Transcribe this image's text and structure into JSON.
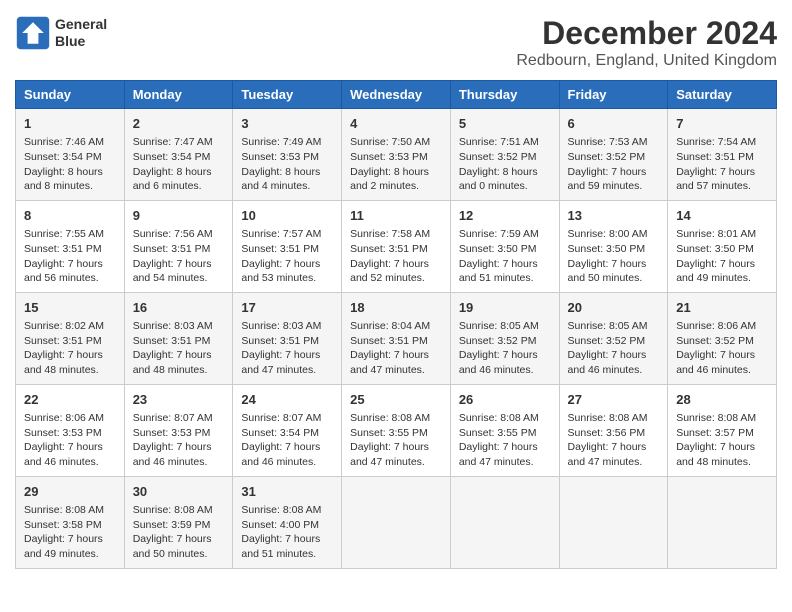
{
  "header": {
    "logo_line1": "General",
    "logo_line2": "Blue",
    "title": "December 2024",
    "subtitle": "Redbourn, England, United Kingdom"
  },
  "columns": [
    "Sunday",
    "Monday",
    "Tuesday",
    "Wednesday",
    "Thursday",
    "Friday",
    "Saturday"
  ],
  "weeks": [
    [
      {
        "day": "1",
        "info": "Sunrise: 7:46 AM\nSunset: 3:54 PM\nDaylight: 8 hours\nand 8 minutes."
      },
      {
        "day": "2",
        "info": "Sunrise: 7:47 AM\nSunset: 3:54 PM\nDaylight: 8 hours\nand 6 minutes."
      },
      {
        "day": "3",
        "info": "Sunrise: 7:49 AM\nSunset: 3:53 PM\nDaylight: 8 hours\nand 4 minutes."
      },
      {
        "day": "4",
        "info": "Sunrise: 7:50 AM\nSunset: 3:53 PM\nDaylight: 8 hours\nand 2 minutes."
      },
      {
        "day": "5",
        "info": "Sunrise: 7:51 AM\nSunset: 3:52 PM\nDaylight: 8 hours\nand 0 minutes."
      },
      {
        "day": "6",
        "info": "Sunrise: 7:53 AM\nSunset: 3:52 PM\nDaylight: 7 hours\nand 59 minutes."
      },
      {
        "day": "7",
        "info": "Sunrise: 7:54 AM\nSunset: 3:51 PM\nDaylight: 7 hours\nand 57 minutes."
      }
    ],
    [
      {
        "day": "8",
        "info": "Sunrise: 7:55 AM\nSunset: 3:51 PM\nDaylight: 7 hours\nand 56 minutes."
      },
      {
        "day": "9",
        "info": "Sunrise: 7:56 AM\nSunset: 3:51 PM\nDaylight: 7 hours\nand 54 minutes."
      },
      {
        "day": "10",
        "info": "Sunrise: 7:57 AM\nSunset: 3:51 PM\nDaylight: 7 hours\nand 53 minutes."
      },
      {
        "day": "11",
        "info": "Sunrise: 7:58 AM\nSunset: 3:51 PM\nDaylight: 7 hours\nand 52 minutes."
      },
      {
        "day": "12",
        "info": "Sunrise: 7:59 AM\nSunset: 3:50 PM\nDaylight: 7 hours\nand 51 minutes."
      },
      {
        "day": "13",
        "info": "Sunrise: 8:00 AM\nSunset: 3:50 PM\nDaylight: 7 hours\nand 50 minutes."
      },
      {
        "day": "14",
        "info": "Sunrise: 8:01 AM\nSunset: 3:50 PM\nDaylight: 7 hours\nand 49 minutes."
      }
    ],
    [
      {
        "day": "15",
        "info": "Sunrise: 8:02 AM\nSunset: 3:51 PM\nDaylight: 7 hours\nand 48 minutes."
      },
      {
        "day": "16",
        "info": "Sunrise: 8:03 AM\nSunset: 3:51 PM\nDaylight: 7 hours\nand 48 minutes."
      },
      {
        "day": "17",
        "info": "Sunrise: 8:03 AM\nSunset: 3:51 PM\nDaylight: 7 hours\nand 47 minutes."
      },
      {
        "day": "18",
        "info": "Sunrise: 8:04 AM\nSunset: 3:51 PM\nDaylight: 7 hours\nand 47 minutes."
      },
      {
        "day": "19",
        "info": "Sunrise: 8:05 AM\nSunset: 3:52 PM\nDaylight: 7 hours\nand 46 minutes."
      },
      {
        "day": "20",
        "info": "Sunrise: 8:05 AM\nSunset: 3:52 PM\nDaylight: 7 hours\nand 46 minutes."
      },
      {
        "day": "21",
        "info": "Sunrise: 8:06 AM\nSunset: 3:52 PM\nDaylight: 7 hours\nand 46 minutes."
      }
    ],
    [
      {
        "day": "22",
        "info": "Sunrise: 8:06 AM\nSunset: 3:53 PM\nDaylight: 7 hours\nand 46 minutes."
      },
      {
        "day": "23",
        "info": "Sunrise: 8:07 AM\nSunset: 3:53 PM\nDaylight: 7 hours\nand 46 minutes."
      },
      {
        "day": "24",
        "info": "Sunrise: 8:07 AM\nSunset: 3:54 PM\nDaylight: 7 hours\nand 46 minutes."
      },
      {
        "day": "25",
        "info": "Sunrise: 8:08 AM\nSunset: 3:55 PM\nDaylight: 7 hours\nand 47 minutes."
      },
      {
        "day": "26",
        "info": "Sunrise: 8:08 AM\nSunset: 3:55 PM\nDaylight: 7 hours\nand 47 minutes."
      },
      {
        "day": "27",
        "info": "Sunrise: 8:08 AM\nSunset: 3:56 PM\nDaylight: 7 hours\nand 47 minutes."
      },
      {
        "day": "28",
        "info": "Sunrise: 8:08 AM\nSunset: 3:57 PM\nDaylight: 7 hours\nand 48 minutes."
      }
    ],
    [
      {
        "day": "29",
        "info": "Sunrise: 8:08 AM\nSunset: 3:58 PM\nDaylight: 7 hours\nand 49 minutes."
      },
      {
        "day": "30",
        "info": "Sunrise: 8:08 AM\nSunset: 3:59 PM\nDaylight: 7 hours\nand 50 minutes."
      },
      {
        "day": "31",
        "info": "Sunrise: 8:08 AM\nSunset: 4:00 PM\nDaylight: 7 hours\nand 51 minutes."
      },
      {
        "day": "",
        "info": ""
      },
      {
        "day": "",
        "info": ""
      },
      {
        "day": "",
        "info": ""
      },
      {
        "day": "",
        "info": ""
      }
    ]
  ]
}
